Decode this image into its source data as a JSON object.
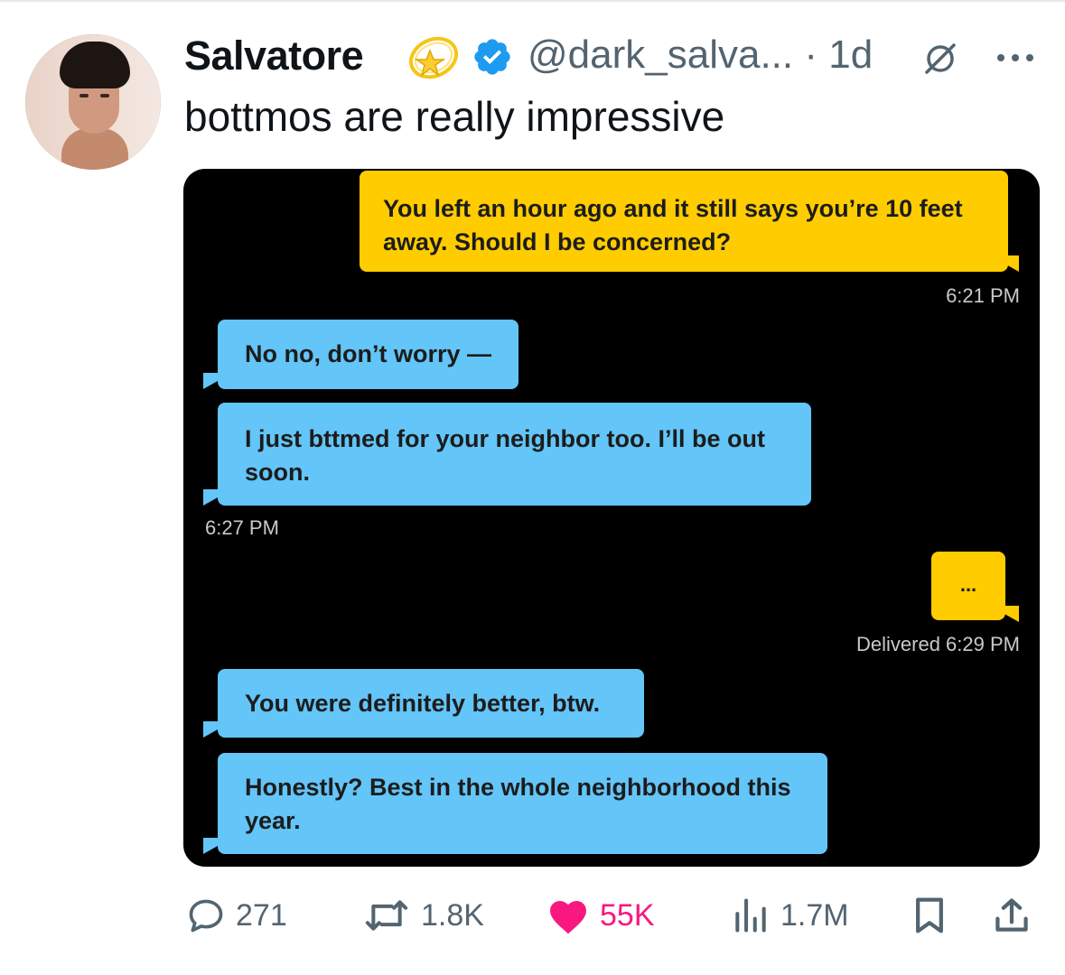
{
  "tweet": {
    "author_name": "Salvatore",
    "handle_time": "@dark_salva... · 1d",
    "text": "bottmos are really impressive"
  },
  "chat": {
    "msg1": {
      "lines": [
        "You left an hour ago and it still says you’re 10 feet",
        "away. Should I be concerned?"
      ],
      "time": "6:21 PM"
    },
    "msg2": {
      "lines": [
        "No no, don’t worry —"
      ]
    },
    "msg3": {
      "lines": [
        "I just bttmed for your neighbor too. I’ll be out",
        "soon."
      ],
      "time": "6:27 PM"
    },
    "msg4": {
      "lines": [
        "..."
      ],
      "time": "Delivered 6:29 PM"
    },
    "msg5": {
      "lines": [
        "You were definitely better, btw."
      ]
    },
    "msg6": {
      "lines": [
        "Honestly? Best in the whole neighborhood this",
        "year."
      ]
    }
  },
  "actions": {
    "replies": "271",
    "reposts": "1.8K",
    "likes": "55K",
    "views": "1.7M"
  },
  "icons": [
    "comet-emoji-icon",
    "verified-badge-icon",
    "grok-icon",
    "more-icon",
    "reply-icon",
    "repost-icon",
    "like-icon",
    "views-icon",
    "bookmark-icon",
    "share-icon"
  ],
  "colors": {
    "yellow_bubble": "#ffcc00",
    "blue_bubble": "#63c5f8",
    "like": "#f91880",
    "verified": "#1d9bf0",
    "muted": "#536471"
  }
}
